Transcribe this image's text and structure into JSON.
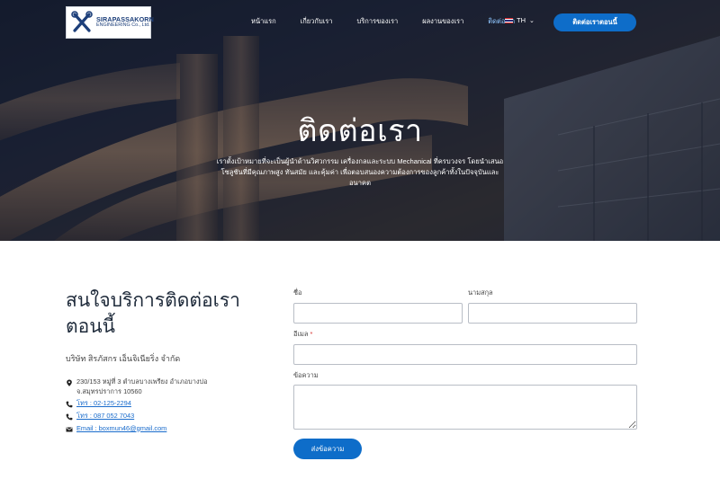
{
  "brand": {
    "logo_name": "SIRAPASSAKORN",
    "logo_sub": "ENGINEERING Co., Ltd."
  },
  "nav": {
    "items": [
      {
        "label": "หน้าแรก",
        "active": false
      },
      {
        "label": "เกี่ยวกับเรา",
        "active": false
      },
      {
        "label": "บริการของเรา",
        "active": false
      },
      {
        "label": "ผลงานของเรา",
        "active": false
      },
      {
        "label": "ติดต่อเรา",
        "active": true
      }
    ],
    "language": "TH",
    "cta_label": "ติดต่อเราตอนนี้"
  },
  "hero": {
    "title": "ติดต่อเรา",
    "description": "เราตั้งเป้าหมายที่จะเป็นผู้นำด้านวิศวกรรม เครื่องกลและระบบ Mechanical ที่ครบวงจร โดยนำเสนอโซลูชันที่มีคุณภาพสูง ทันสมัย และคุ้มค่า เพื่อตอบสนองความต้องการของลูกค้าทั้งในปัจจุบันและอนาคต"
  },
  "contact": {
    "heading": "สนใจบริการติดต่อเราตอนนี้",
    "company": "บริษัท สิรภัสกร เอ็นจิเนียริ่ง จำกัด",
    "address": "230/153 หมู่ที่ 3 ตำบลบางเพรียง อำเภอบางบ่อ จ.สมุทรปราการ 10560",
    "phone1": "โทร : 02-125-2294",
    "phone2": "โทร : 087 052 7043",
    "email": "Email : boxmun46@gmail.com"
  },
  "form": {
    "first_name_label": "ชื่อ",
    "first_name_value": "",
    "last_name_label": "นามสกุล",
    "last_name_value": "",
    "email_label": "อีเมล",
    "required_mark": "*",
    "email_value": "",
    "message_label": "ข้อความ",
    "message_value": "",
    "submit_label": "ส่งข้อความ"
  },
  "colors": {
    "accent": "#0e6dc9",
    "nav_active": "#8fc6ff",
    "required": "#d6322e"
  }
}
